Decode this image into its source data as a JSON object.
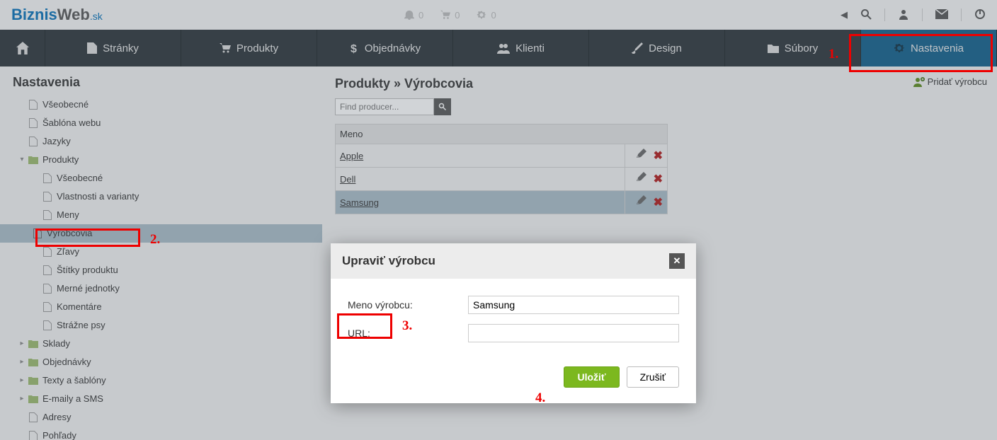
{
  "logo": {
    "part1": "Biznis",
    "part2": "Web",
    "tld": ".sk"
  },
  "topCounters": [
    "0",
    "0",
    "0"
  ],
  "nav": {
    "stranky": "Stránky",
    "produkty": "Produkty",
    "objednavky": "Objednávky",
    "klienti": "Klienti",
    "design": "Design",
    "subory": "Súbory",
    "nastavenia": "Nastavenia"
  },
  "sidebar": {
    "title": "Nastavenia",
    "items": {
      "vseobecne": "Všeobecné",
      "sablona": "Šablóna webu",
      "jazyky": "Jazyky",
      "produkty": "Produkty",
      "p_vseobecne": "Všeobecné",
      "p_vlastnosti": "Vlastnosti a varianty",
      "p_meny": "Meny",
      "p_vyrobcovia": "Výrobcovia",
      "p_zlavy": "Zľavy",
      "p_stitky": "Štítky produktu",
      "p_merne": "Merné jednotky",
      "p_komentare": "Komentáre",
      "p_strazne": "Strážne psy",
      "sklady": "Sklady",
      "objednavky": "Objednávky",
      "texty": "Texty a šablóny",
      "emaily": "E-maily a SMS",
      "adresy": "Adresy",
      "pohlady": "Pohľady"
    }
  },
  "content": {
    "breadcrumb": "Produkty » Výrobcovia",
    "addLabel": "Pridať výrobcu",
    "searchPlaceholder": "Find producer...",
    "tableHeader": "Meno",
    "rows": [
      "Apple",
      "Dell",
      "Samsung"
    ]
  },
  "modal": {
    "title": "Upraviť výrobcu",
    "nameLabel": "Meno výrobcu:",
    "nameValue": "Samsung",
    "urlLabel": "URL:",
    "urlValue": "",
    "save": "Uložiť",
    "cancel": "Zrušiť"
  },
  "ann": {
    "n1": "1.",
    "n2": "2.",
    "n3": "3.",
    "n4": "4."
  }
}
